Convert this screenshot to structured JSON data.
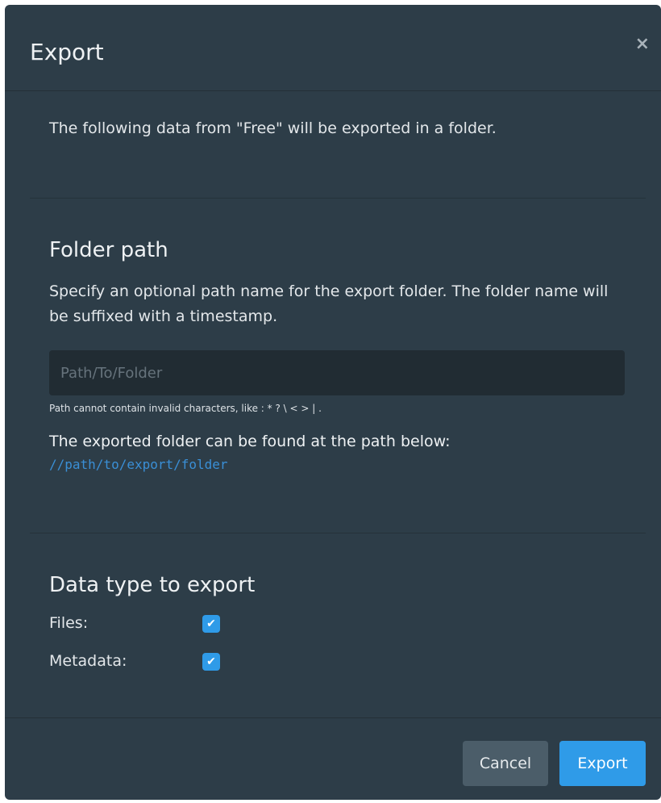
{
  "dialog": {
    "title": "Export",
    "close_glyph": "×",
    "intro": "The following data from \"Free\" will be exported in a folder."
  },
  "folder": {
    "title": "Folder path",
    "description": "Specify an optional path name for the export folder. The folder name will be suffixed with a timestamp.",
    "input_value": "",
    "input_placeholder": "Path/To/Folder",
    "hint": "Path cannot contain invalid characters, like : * ? \\ < > | .",
    "found_text": "The exported folder can be found at the path below:",
    "found_path": "//path/to/export/folder"
  },
  "datatype": {
    "title": "Data type to export",
    "options": [
      {
        "label": "Files:",
        "checked": true
      },
      {
        "label": "Metadata:",
        "checked": true
      }
    ],
    "check_glyph": "✔"
  },
  "footer": {
    "cancel_label": "Cancel",
    "export_label": "Export"
  },
  "colors": {
    "dialog_bg": "#2d3d48",
    "input_bg": "#212c33",
    "accent": "#2f9be8",
    "path_link": "#3a8fd6",
    "cancel_bg": "#4b5d69"
  }
}
